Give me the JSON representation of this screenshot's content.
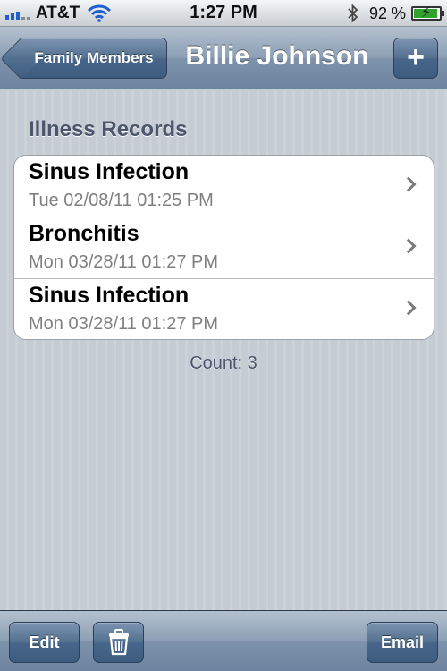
{
  "status_bar": {
    "carrier": "AT&T",
    "time": "1:27 PM",
    "battery_percent": "92 %",
    "battery_level": 0.92,
    "signal_bars": 5,
    "signal_bars_active": 3
  },
  "nav": {
    "back_label": "Family Members",
    "title": "Billie Johnson",
    "add_label": "+"
  },
  "section": {
    "header": "Illness Records"
  },
  "records": [
    {
      "title": "Sinus Infection",
      "date": "Tue 02/08/11 01:25 PM"
    },
    {
      "title": "Bronchitis",
      "date": "Mon 03/28/11 01:27 PM"
    },
    {
      "title": "Sinus Infection",
      "date": "Mon 03/28/11 01:27 PM"
    }
  ],
  "count_text": "Count: 3",
  "toolbar": {
    "edit_label": "Edit",
    "email_label": "Email"
  },
  "icons": {
    "signal": "signal-bars-icon",
    "wifi": "wifi-icon",
    "bluetooth": "bluetooth-icon",
    "battery": "battery-charging-icon",
    "chevron": "chevron-right-icon",
    "trash": "trash-icon"
  },
  "colors": {
    "nav_tint": "#6d84a0",
    "background": "#c5ccd4",
    "section_text": "#4c566c"
  }
}
